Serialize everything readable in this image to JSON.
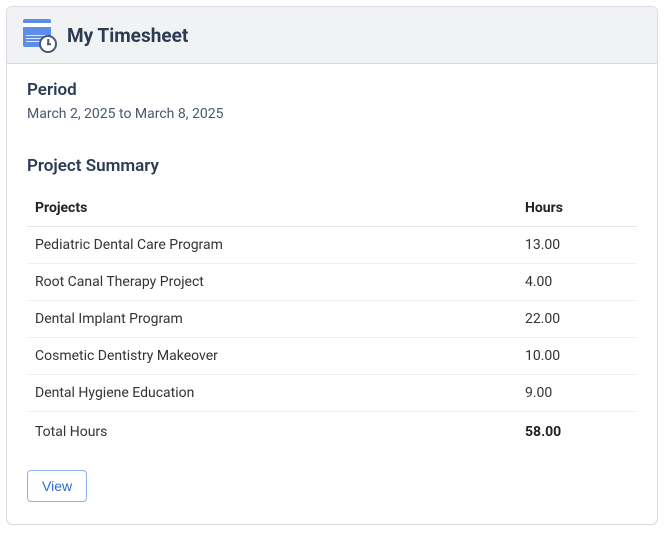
{
  "header": {
    "title": "My Timesheet"
  },
  "period": {
    "label": "Period",
    "value": "March 2, 2025 to March 8, 2025"
  },
  "summary": {
    "title": "Project Summary",
    "columns": {
      "projects": "Projects",
      "hours": "Hours"
    },
    "rows": [
      {
        "project": "Pediatric Dental Care Program",
        "hours": "13.00"
      },
      {
        "project": "Root Canal Therapy Project",
        "hours": "4.00"
      },
      {
        "project": "Dental Implant Program",
        "hours": "22.00"
      },
      {
        "project": "Cosmetic Dentistry Makeover",
        "hours": "10.00"
      },
      {
        "project": "Dental Hygiene Education",
        "hours": "9.00"
      }
    ],
    "total": {
      "label": "Total Hours",
      "hours": "58.00"
    }
  },
  "actions": {
    "view_label": "View"
  }
}
